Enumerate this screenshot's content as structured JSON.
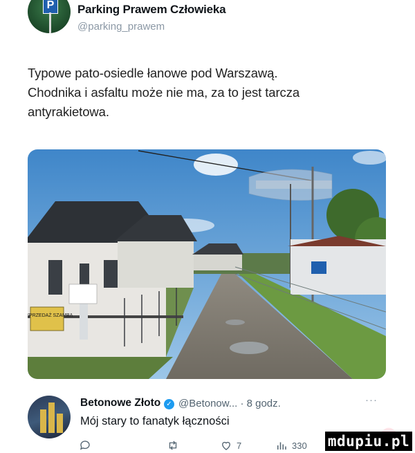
{
  "post": {
    "author_name": "Parking Prawem Człowieka",
    "author_handle": "@parking_prawem",
    "avatar_sign": "P",
    "text_lines": [
      "Typowe pato-osiedle łanowe pod Warszawą.",
      "Chodnika i asfaltu może nie ma, za to jest tarcza",
      "antyrakietowa."
    ],
    "image": {
      "sign_text": "WYPRZEDAŻ SZAMBA"
    }
  },
  "reply": {
    "author_name": "Betonowe Złoto",
    "badge": "®",
    "meta": "@Betonow... · 8 godz.",
    "more": "···",
    "text": "Mój stary to fanatyk łączności",
    "actions": {
      "reply": "",
      "retweet": "",
      "like": "7",
      "views": "330"
    }
  },
  "watermark": "mdupiu.pl",
  "colors": {
    "verified": "#1d9bf0",
    "secondary_text": "#536471",
    "watermark_bg": "#000000"
  }
}
